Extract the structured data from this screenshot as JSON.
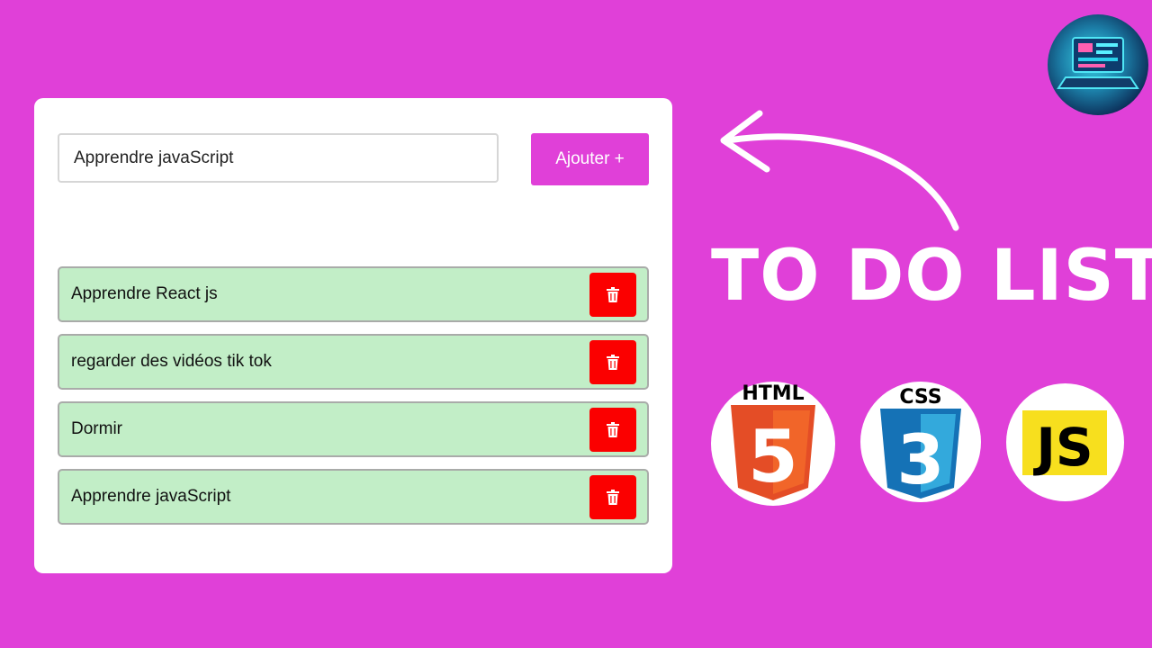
{
  "todo": {
    "input_value": "Apprendre javaScript",
    "add_button_label": "Ajouter +",
    "items": [
      {
        "text": "Apprendre React js"
      },
      {
        "text": "regarder des vidéos tik tok"
      },
      {
        "text": "Dormir"
      },
      {
        "text": "Apprendre javaScript"
      }
    ]
  },
  "heading": "TO DO LIST",
  "logos": {
    "html": {
      "label": "HTML",
      "number": "5"
    },
    "css": {
      "label": "CSS",
      "number": "3"
    },
    "js": {
      "label": "JS"
    }
  },
  "colors": {
    "background": "#e040d8",
    "accent": "#e040d8",
    "item_bg": "#c2eec7",
    "delete": "#fb0000"
  },
  "icons": [
    "trash-icon",
    "arrow-icon",
    "html5-logo",
    "css3-logo",
    "js-logo",
    "avatar"
  ]
}
